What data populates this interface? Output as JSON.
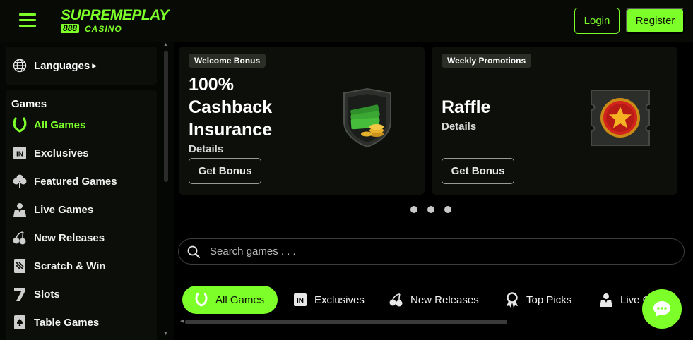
{
  "header": {
    "logo_main": "SUPREMEPLAY",
    "logo_888": "888",
    "logo_sub": "CASINO",
    "login_label": "Login",
    "register_label": "Register"
  },
  "sidebar": {
    "languages_label": "Languages",
    "games_title": "Games",
    "items": [
      {
        "label": "All Games",
        "icon": "horseshoe-icon",
        "active": true
      },
      {
        "label": "Exclusives",
        "icon": "in-badge-icon"
      },
      {
        "label": "Featured Games",
        "icon": "clover-icon"
      },
      {
        "label": "Live Games",
        "icon": "dealer-icon"
      },
      {
        "label": "New Releases",
        "icon": "cherries-icon"
      },
      {
        "label": "Scratch & Win",
        "icon": "scratch-card-icon"
      },
      {
        "label": "Slots",
        "icon": "seven-icon"
      },
      {
        "label": "Table Games",
        "icon": "playing-card-icon"
      }
    ]
  },
  "promos": [
    {
      "badge": "Welcome Bonus",
      "title": "100% Cashback Insurance",
      "details": "Details",
      "button": "Get Bonus",
      "art": "cash-stack-shield-icon"
    },
    {
      "badge": "Weekly Promotions",
      "title": "Raffle",
      "details": "Details",
      "button": "Get Bonus",
      "art": "raffle-ticket-star-icon"
    }
  ],
  "carousel": {
    "dot_count": 3
  },
  "search": {
    "placeholder": "Search games . . ."
  },
  "tabs": [
    {
      "label": "All Games",
      "icon": "horseshoe-icon",
      "active": true
    },
    {
      "label": "Exclusives",
      "icon": "in-badge-icon"
    },
    {
      "label": "New Releases",
      "icon": "cherries-icon"
    },
    {
      "label": "Top Picks",
      "icon": "award-ribbon-icon"
    },
    {
      "label": "Live Games",
      "icon": "dealer-icon"
    }
  ],
  "colors": {
    "accent": "#7dff2a",
    "background": "#000000",
    "panel": "#0b0e09"
  }
}
